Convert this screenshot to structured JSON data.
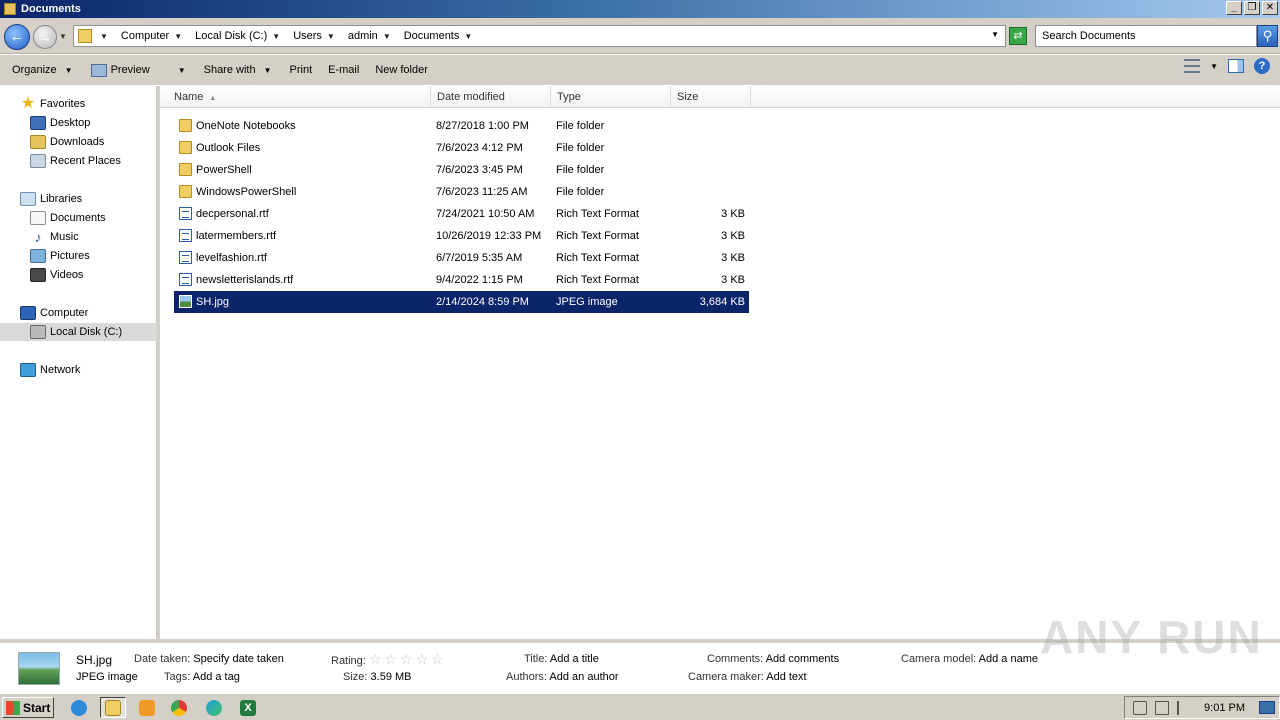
{
  "window": {
    "title": "Documents"
  },
  "address": {
    "crumbs": [
      "Computer",
      "Local Disk (C:)",
      "Users",
      "admin",
      "Documents"
    ],
    "search_placeholder": "Search Documents"
  },
  "toolbar": {
    "organize": "Organize",
    "preview": "Preview",
    "share_with": "Share with",
    "print": "Print",
    "email": "E-mail",
    "new_folder": "New folder"
  },
  "nav": {
    "favorites": "Favorites",
    "desktop": "Desktop",
    "downloads": "Downloads",
    "recent_places": "Recent Places",
    "libraries": "Libraries",
    "documents": "Documents",
    "music": "Music",
    "pictures": "Pictures",
    "videos": "Videos",
    "computer": "Computer",
    "local_disk": "Local Disk (C:)",
    "network": "Network"
  },
  "columns": {
    "name": "Name",
    "date": "Date modified",
    "type": "Type",
    "size": "Size"
  },
  "files": [
    {
      "name": "OneNote Notebooks",
      "date": "8/27/2018 1:00 PM",
      "type": "File folder",
      "size": "",
      "icon": "folder-icon"
    },
    {
      "name": "Outlook Files",
      "date": "7/6/2023 4:12 PM",
      "type": "File folder",
      "size": "",
      "icon": "folder-icon"
    },
    {
      "name": "PowerShell",
      "date": "7/6/2023 3:45 PM",
      "type": "File folder",
      "size": "",
      "icon": "folder-icon"
    },
    {
      "name": "WindowsPowerShell",
      "date": "7/6/2023 11:25 AM",
      "type": "File folder",
      "size": "",
      "icon": "folder-icon"
    },
    {
      "name": "decpersonal.rtf",
      "date": "7/24/2021 10:50 AM",
      "type": "Rich Text Format",
      "size": "3 KB",
      "icon": "rtf-file-icon"
    },
    {
      "name": "latermembers.rtf",
      "date": "10/26/2019 12:33 PM",
      "type": "Rich Text Format",
      "size": "3 KB",
      "icon": "rtf-file-icon"
    },
    {
      "name": "levelfashion.rtf",
      "date": "6/7/2019 5:35 AM",
      "type": "Rich Text Format",
      "size": "3 KB",
      "icon": "rtf-file-icon"
    },
    {
      "name": "newsletterislands.rtf",
      "date": "9/4/2022 1:15 PM",
      "type": "Rich Text Format",
      "size": "3 KB",
      "icon": "rtf-file-icon"
    },
    {
      "name": "SH.jpg",
      "date": "2/14/2024 8:59 PM",
      "type": "JPEG image",
      "size": "3,684 KB",
      "icon": "jpeg-file-icon",
      "selected": true
    }
  ],
  "details": {
    "filename": "SH.jpg",
    "filetype": "JPEG image",
    "date_taken_label": "Date taken:",
    "date_taken_value": "Specify date taken",
    "tags_label": "Tags:",
    "tags_value": "Add a tag",
    "rating_label": "Rating:",
    "rating_stars": "☆☆☆☆☆",
    "size_label": "Size:",
    "size_value": "3.59 MB",
    "title_label": "Title:",
    "title_value": "Add a title",
    "authors_label": "Authors:",
    "authors_value": "Add an author",
    "comments_label": "Comments:",
    "comments_value": "Add comments",
    "camera_maker_label": "Camera maker:",
    "camera_maker_value": "Add text",
    "camera_model_label": "Camera model:",
    "camera_model_value": "Add a name"
  },
  "watermark": "ANY RUN",
  "taskbar": {
    "start": "Start",
    "clock": "9:01 PM"
  }
}
